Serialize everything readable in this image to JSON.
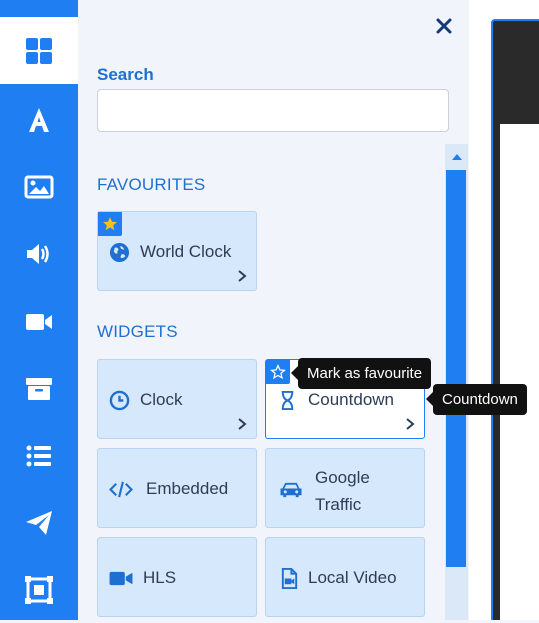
{
  "panel": {
    "search_label": "Search",
    "search_value": "",
    "search_placeholder": ""
  },
  "sections": {
    "favourites_title": "FAVOURITES",
    "widgets_title": "WIDGETS"
  },
  "favourites": [
    {
      "label": "World Clock",
      "icon": "globe-icon",
      "favourite": true
    }
  ],
  "widgets": [
    {
      "label": "Clock",
      "icon": "clock-icon"
    },
    {
      "label": "Countdown",
      "icon": "hourglass-icon"
    },
    {
      "label": "Embedded",
      "icon": "code-icon"
    },
    {
      "label_line1": "Google",
      "label_line2": "Traffic",
      "icon": "car-icon"
    },
    {
      "label": "HLS",
      "icon": "video-camera-icon"
    },
    {
      "label": "Local Video",
      "icon": "file-video-icon"
    }
  ],
  "tooltips": {
    "favourite": "Mark as favourite",
    "widget": "Countdown"
  },
  "rail_icons": [
    "dashboard-icon",
    "text-font-icon",
    "image-icon",
    "audio-volume-icon",
    "video-icon",
    "archive-box-icon",
    "list-icon",
    "send-paper-plane-icon",
    "layout-frame-icon"
  ],
  "colors": {
    "accent": "#1f7ef1",
    "card_bg": "#d6e8fb",
    "text": "#2d3e54",
    "section_title": "#1f6fd1",
    "tooltip_bg": "#111111"
  }
}
